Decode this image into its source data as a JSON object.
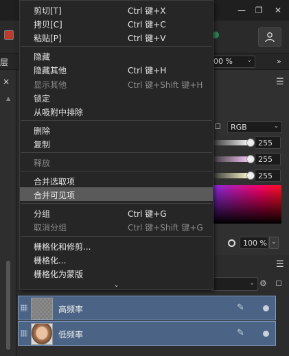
{
  "window": {
    "minimize_icon": "minimize-icon",
    "restore_icon": "restore-icon",
    "close_icon": "close-icon"
  },
  "toolbar": {
    "user_icon": "user-icon",
    "context_left_label": "层",
    "zoom_value": "00 %",
    "expand_label": "»"
  },
  "left_panel": {
    "close_label": "×"
  },
  "color_panel": {
    "mode": "RGB",
    "channels": [
      {
        "value": "255",
        "level": 1.0,
        "color": "#ffffff"
      },
      {
        "value": "255",
        "level": 1.0,
        "color": "#ffccff"
      },
      {
        "value": "255",
        "level": 1.0,
        "color": "#ffffcc"
      }
    ],
    "opacity_value": "100 %"
  },
  "layers": [
    {
      "name": "高频率",
      "thumb": "gray"
    },
    {
      "name": "低频率",
      "thumb": "face"
    }
  ],
  "menu": {
    "groups": [
      [
        {
          "label": "剪切[T]",
          "shortcut": "Ctrl 键+X",
          "disabled": false
        },
        {
          "label": "拷贝[C]",
          "shortcut": "Ctrl 键+C",
          "disabled": false
        },
        {
          "label": "粘贴[P]",
          "shortcut": "Ctrl 键+V",
          "disabled": false
        }
      ],
      [
        {
          "label": "隐藏",
          "shortcut": "",
          "disabled": false
        },
        {
          "label": "隐藏其他",
          "shortcut": "Ctrl 键+H",
          "disabled": false
        },
        {
          "label": "显示其他",
          "shortcut": "Ctrl 键+Shift 键+H",
          "disabled": true
        },
        {
          "label": "锁定",
          "shortcut": "",
          "disabled": false
        },
        {
          "label": "从吸附中排除",
          "shortcut": "",
          "disabled": false
        }
      ],
      [
        {
          "label": "删除",
          "shortcut": "",
          "disabled": false
        },
        {
          "label": "复制",
          "shortcut": "",
          "disabled": false
        }
      ],
      [
        {
          "label": "释放",
          "shortcut": "",
          "disabled": true
        }
      ],
      [
        {
          "label": "合并选取项",
          "shortcut": "",
          "disabled": false
        },
        {
          "label": "合并可见项",
          "shortcut": "",
          "disabled": false,
          "highlighted": true
        }
      ],
      [
        {
          "label": "分组",
          "shortcut": "Ctrl 键+G",
          "disabled": false
        },
        {
          "label": "取消分组",
          "shortcut": "Ctrl 键+Shift 键+G",
          "disabled": true
        }
      ],
      [
        {
          "label": "栅格化和修剪...",
          "shortcut": "",
          "disabled": false
        },
        {
          "label": "栅格化...",
          "shortcut": "",
          "disabled": false
        },
        {
          "label": "栅格化为蒙版",
          "shortcut": "",
          "disabled": false
        }
      ]
    ]
  }
}
